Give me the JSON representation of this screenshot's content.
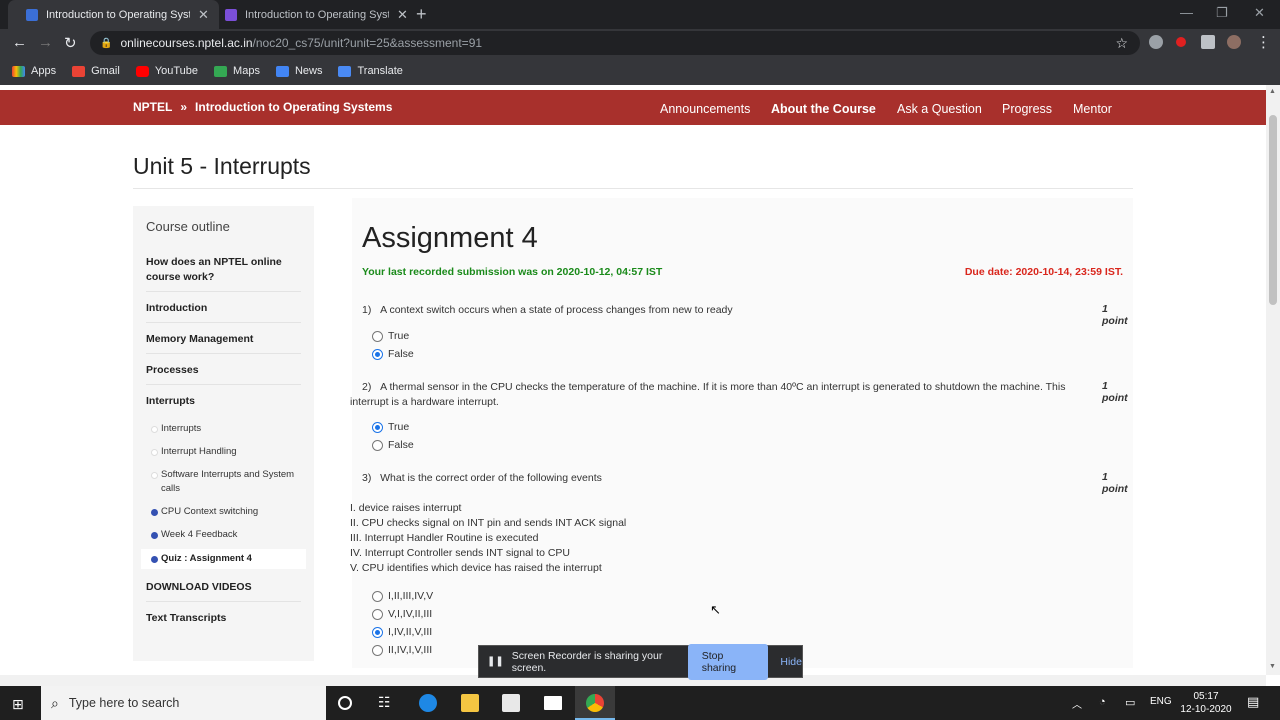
{
  "browser": {
    "tabs": [
      {
        "title": "Introduction to Operating Systems",
        "active": true
      },
      {
        "title": "Introduction to Operating Systems",
        "active": false
      }
    ],
    "url_host": "onlinecourses.nptel.ac.in",
    "url_path": "/noc20_cs75/unit?unit=25&assessment=91",
    "bookmarks": [
      "Apps",
      "Gmail",
      "YouTube",
      "Maps",
      "News",
      "Translate"
    ]
  },
  "header": {
    "brand": "NPTEL",
    "separator": "»",
    "course": "Introduction to Operating Systems",
    "nav": [
      "Announcements",
      "About the Course",
      "Ask a Question",
      "Progress",
      "Mentor"
    ]
  },
  "unit_title": "Unit 5 - Interrupts",
  "sidebar": {
    "heading": "Course outline",
    "items": [
      "How does an NPTEL online course work?",
      "Introduction",
      "Memory Management",
      "Processes",
      "Interrupts"
    ],
    "subitems": [
      {
        "label": "Interrupts",
        "status": "empty"
      },
      {
        "label": "Interrupt Handling",
        "status": "empty"
      },
      {
        "label": "Software Interrupts and System calls",
        "status": "empty"
      },
      {
        "label": "CPU Context switching",
        "status": "done"
      },
      {
        "label": "Week 4 Feedback",
        "status": "done"
      },
      {
        "label": "Quiz : Assignment 4",
        "status": "done"
      }
    ],
    "bottom_items": [
      "DOWNLOAD VIDEOS",
      "Text Transcripts"
    ]
  },
  "assignment": {
    "title": "Assignment 4",
    "last_submission": "Your last recorded submission was on 2020-10-12, 04:57 IST",
    "due": "Due date: 2020-10-14, 23:59 IST.",
    "points_label": "1 point",
    "questions": [
      {
        "number": "1)",
        "text": "A context switch occurs when a state of process changes from new to ready",
        "options": [
          "True",
          "False"
        ],
        "selected": 1
      },
      {
        "number": "2)",
        "text": "A thermal sensor in the CPU checks the temperature of the machine. If it is more than 40ºC an interrupt is generated to shutdown the machine. This",
        "text2": "interrupt is a hardware interrupt.",
        "options": [
          "True",
          "False"
        ],
        "selected": 0
      },
      {
        "number": "3)",
        "text": "What is the correct order of the following events",
        "events": [
          "I. device raises interrupt",
          "II. CPU checks signal on INT pin and sends INT ACK signal",
          "III. Interrupt Handler Routine is executed",
          "IV. Interrupt Controller sends INT signal to CPU",
          "V. CPU identifies which device has raised the interrupt"
        ],
        "options": [
          "I,II,III,IV,V",
          "V,I,IV,II,III",
          "I,IV,II,V,III",
          "II,IV,I,V,III"
        ],
        "selected": 2
      }
    ]
  },
  "sharebar": {
    "message": "Screen Recorder is sharing your screen.",
    "stop": "Stop sharing",
    "hide": "Hide"
  },
  "taskbar": {
    "search_placeholder": "Type here to search",
    "lang": "ENG",
    "time": "05:17",
    "date": "12-10-2020"
  }
}
